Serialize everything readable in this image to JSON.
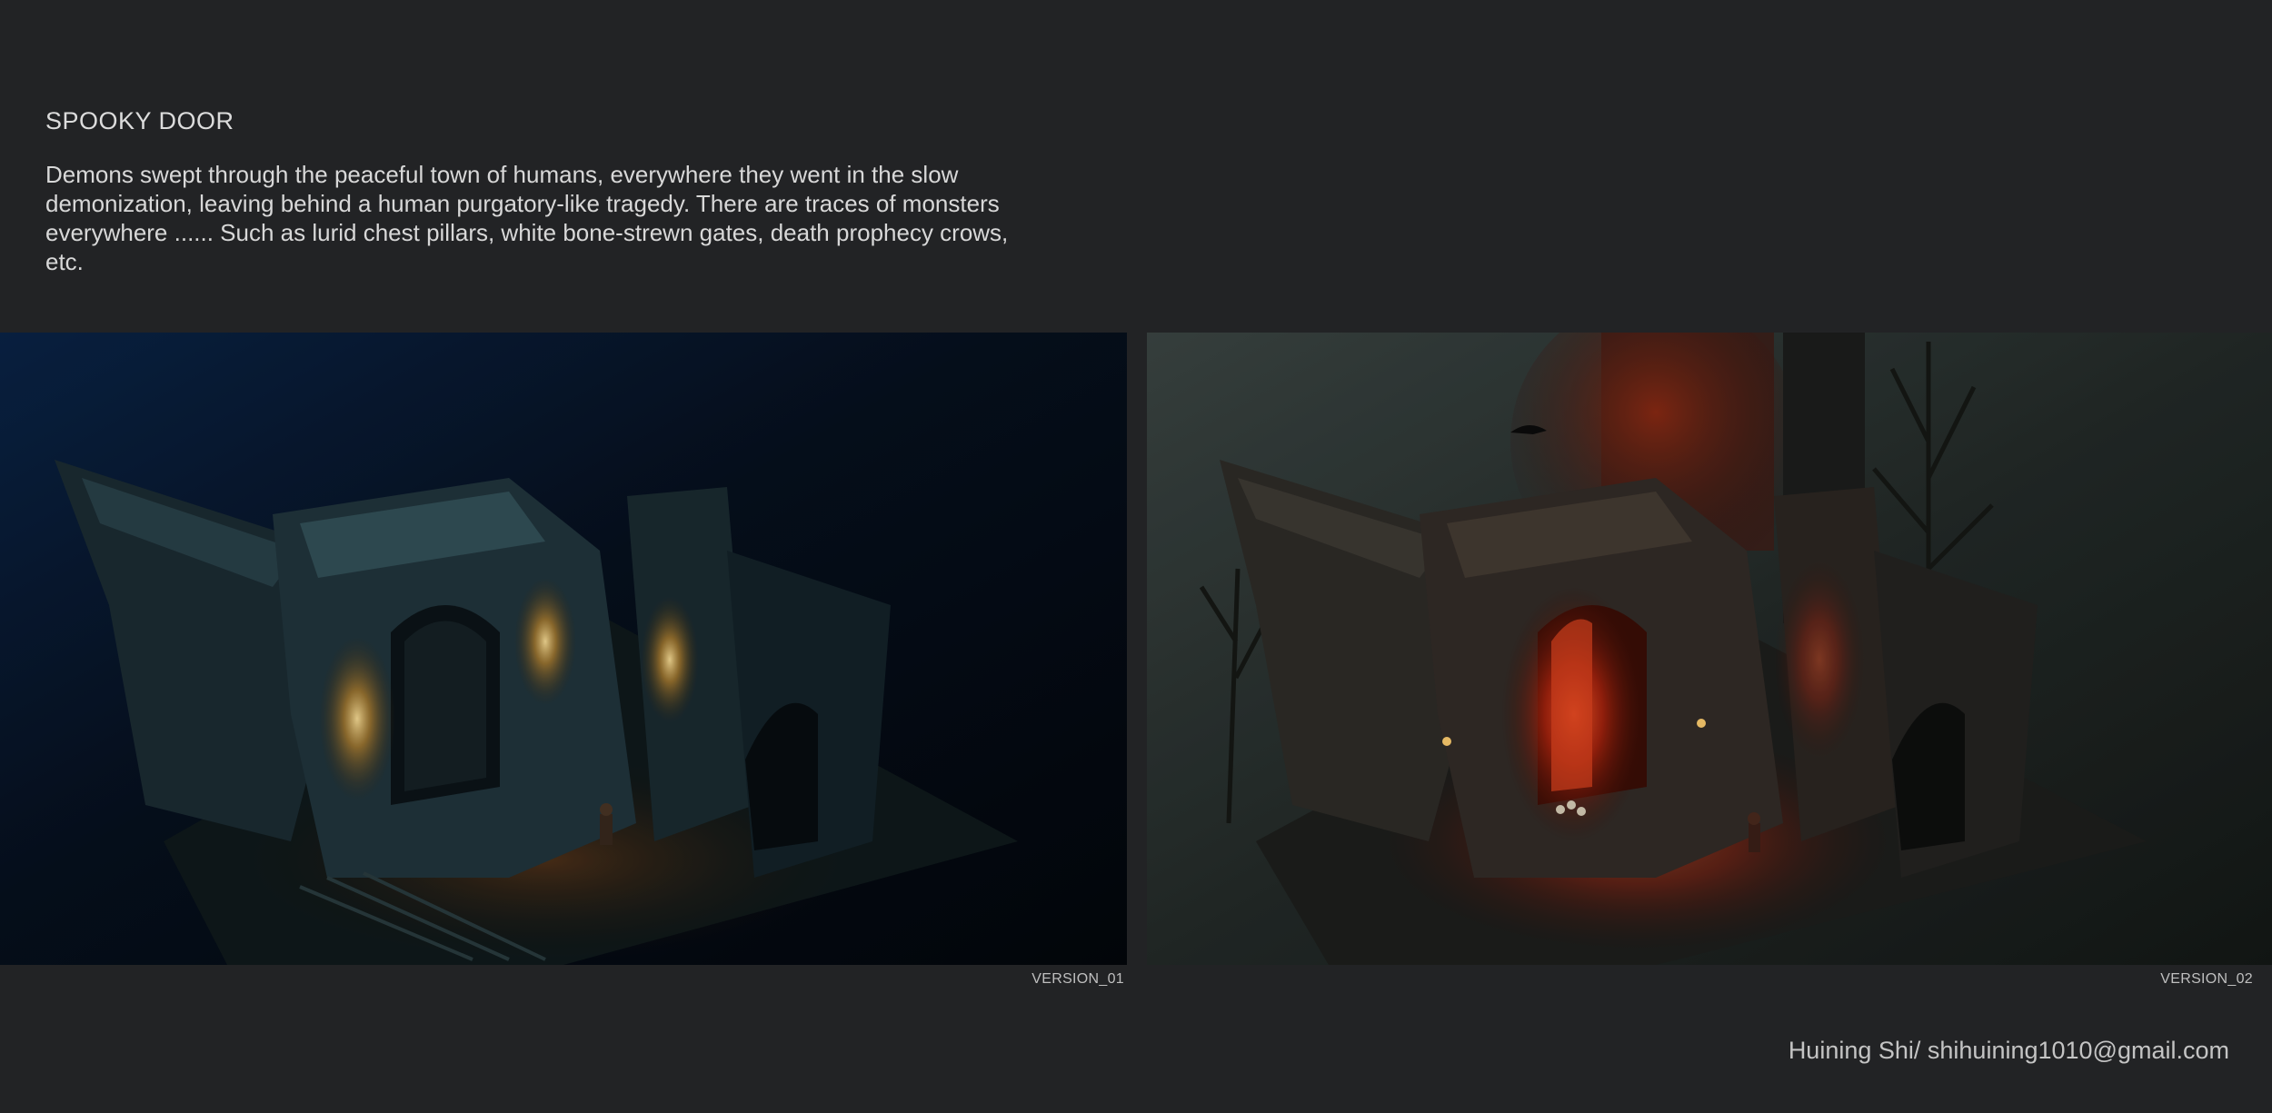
{
  "header": {
    "title": "SPOOKY DOOR",
    "description": "Demons swept through the peaceful town of humans, everywhere they went in the slow demonization, leaving behind a human purgatory-like tragedy. There are traces of monsters everywhere ...... Such as lurid chest pillars, white bone-strewn gates, death prophecy crows, etc."
  },
  "images": [
    {
      "caption": "VERSION_01",
      "palette": {
        "sky": "#06152b",
        "glow": "#c99a3a",
        "stone": "#23363f"
      }
    },
    {
      "caption": "VERSION_02",
      "palette": {
        "sky": "#2c3634",
        "glow": "#e0381c",
        "stone": "#2e2a26"
      }
    }
  ],
  "footer": {
    "credit": "Huining Shi/ shihuining1010@gmail.com"
  }
}
